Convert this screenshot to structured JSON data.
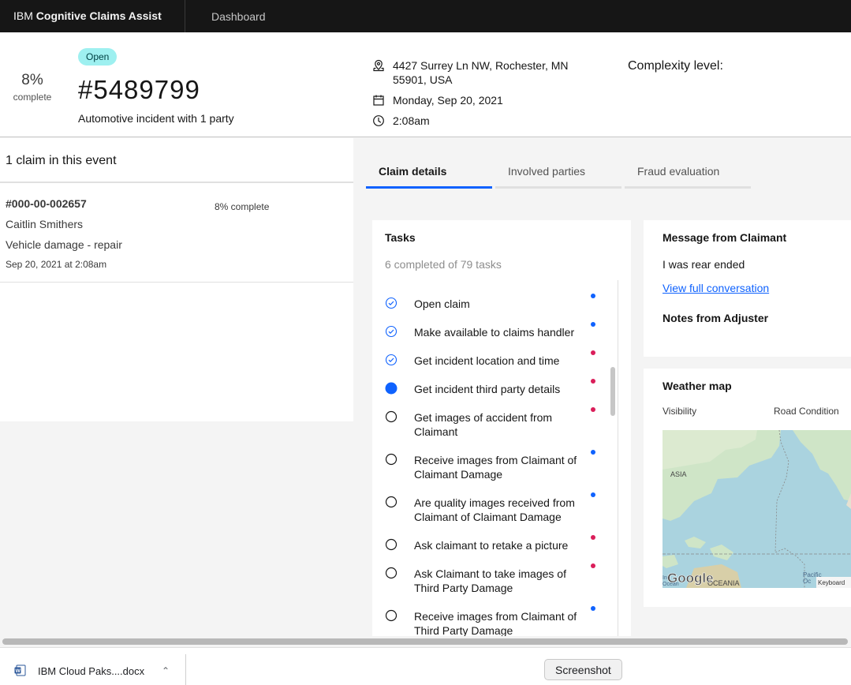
{
  "app": {
    "brand_prefix": "IBM",
    "brand_name": "Cognitive Claims Assist",
    "nav_item": "Dashboard"
  },
  "summary": {
    "percent": "8%",
    "percent_label": "complete",
    "status": "Open",
    "claim_number": "#5489799",
    "description": "Automotive incident with 1 party",
    "address": "4427 Surrey Ln NW, Rochester, MN 55901, USA",
    "date": "Monday, Sep 20, 2021",
    "time": "2:08am",
    "complexity_label": "Complexity level:"
  },
  "claims_panel": {
    "heading": "1 claim in this event",
    "claim": {
      "id": "#000-00-002657",
      "claimant": "Caitlin Smithers",
      "type": "Vehicle damage - repair",
      "date": "Sep 20, 2021 at 2:08am",
      "progress": "8% complete"
    }
  },
  "tabs": [
    {
      "label": "Claim details",
      "active": true
    },
    {
      "label": "Involved parties",
      "active": false
    },
    {
      "label": "Fraud evaluation",
      "active": false
    }
  ],
  "tasks": {
    "title": "Tasks",
    "subtitle": "6 completed of 79 tasks",
    "items": [
      {
        "label": "Open claim",
        "state": "done",
        "dot": "blue"
      },
      {
        "label": "Make available to claims handler",
        "state": "done",
        "dot": "blue"
      },
      {
        "label": "Get incident location and time",
        "state": "done",
        "dot": "red"
      },
      {
        "label": "Get incident third party details",
        "state": "current",
        "dot": "red"
      },
      {
        "label": "Get images of accident from Claimant",
        "state": "todo",
        "dot": "red"
      },
      {
        "label": "Receive images from Claimant of Claimant Damage",
        "state": "todo",
        "dot": "blue"
      },
      {
        "label": "Are quality images received from Claimant of Claimant Damage",
        "state": "todo",
        "dot": "blue"
      },
      {
        "label": "Ask claimant to retake a picture",
        "state": "todo",
        "dot": "red"
      },
      {
        "label": "Ask Claimant to take images of Third Party Damage",
        "state": "todo",
        "dot": "red"
      },
      {
        "label": "Receive images from Claimant of Third Party Damage",
        "state": "todo",
        "dot": "blue"
      }
    ]
  },
  "message_card": {
    "title": "Message from Claimant",
    "message": "I was rear ended",
    "link": "View full conversation",
    "notes_title": "Notes from Adjuster"
  },
  "weather": {
    "title": "Weather map",
    "visibility_label": "Visibility",
    "road_label": "Road Condition",
    "map_labels": {
      "asia": "ASIA",
      "oceania": "OCEANIA",
      "pacific": "Pacific",
      "ocean": "Oc",
      "left_ocean": "Ind",
      "left_ocean2": "Ocean",
      "google": "Google",
      "keyboard": "Keyboard"
    }
  },
  "download_bar": {
    "file_name": "IBM Cloud Paks....docx",
    "tooltip": "Screenshot"
  },
  "colors": {
    "accent": "#0f62fe",
    "status_tag": "#9ef0f0",
    "dot_red": "#da1e5a",
    "dot_blue": "#0f62fe",
    "header_bg": "#161616"
  }
}
